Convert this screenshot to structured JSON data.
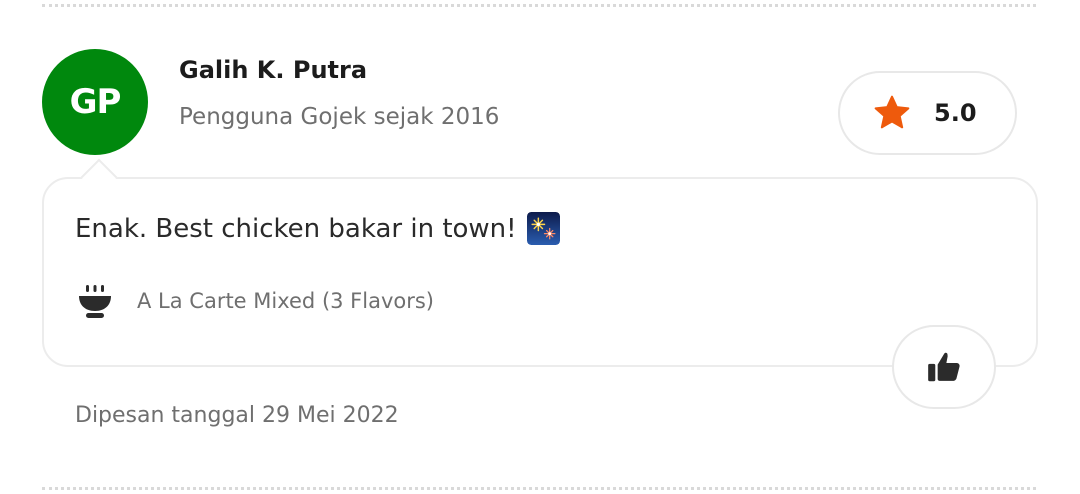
{
  "review": {
    "avatar_initials": "GP",
    "avatar_color": "#00880d",
    "reviewer_name": "Galih K. Putra",
    "reviewer_since": "Pengguna Gojek sejak 2016",
    "rating": "5.0",
    "rating_icon": "star-icon",
    "star_color": "#ee5a0c",
    "comment": "Enak. Best chicken bakar in town!",
    "comment_emoji": "fireworks-emoji",
    "menu_icon": "bowl-icon",
    "menu_item": "A La Carte Mixed (3 Flavors)",
    "like_icon": "thumbs-up-icon",
    "order_date": "Dipesan tanggal 29 Mei 2022"
  }
}
